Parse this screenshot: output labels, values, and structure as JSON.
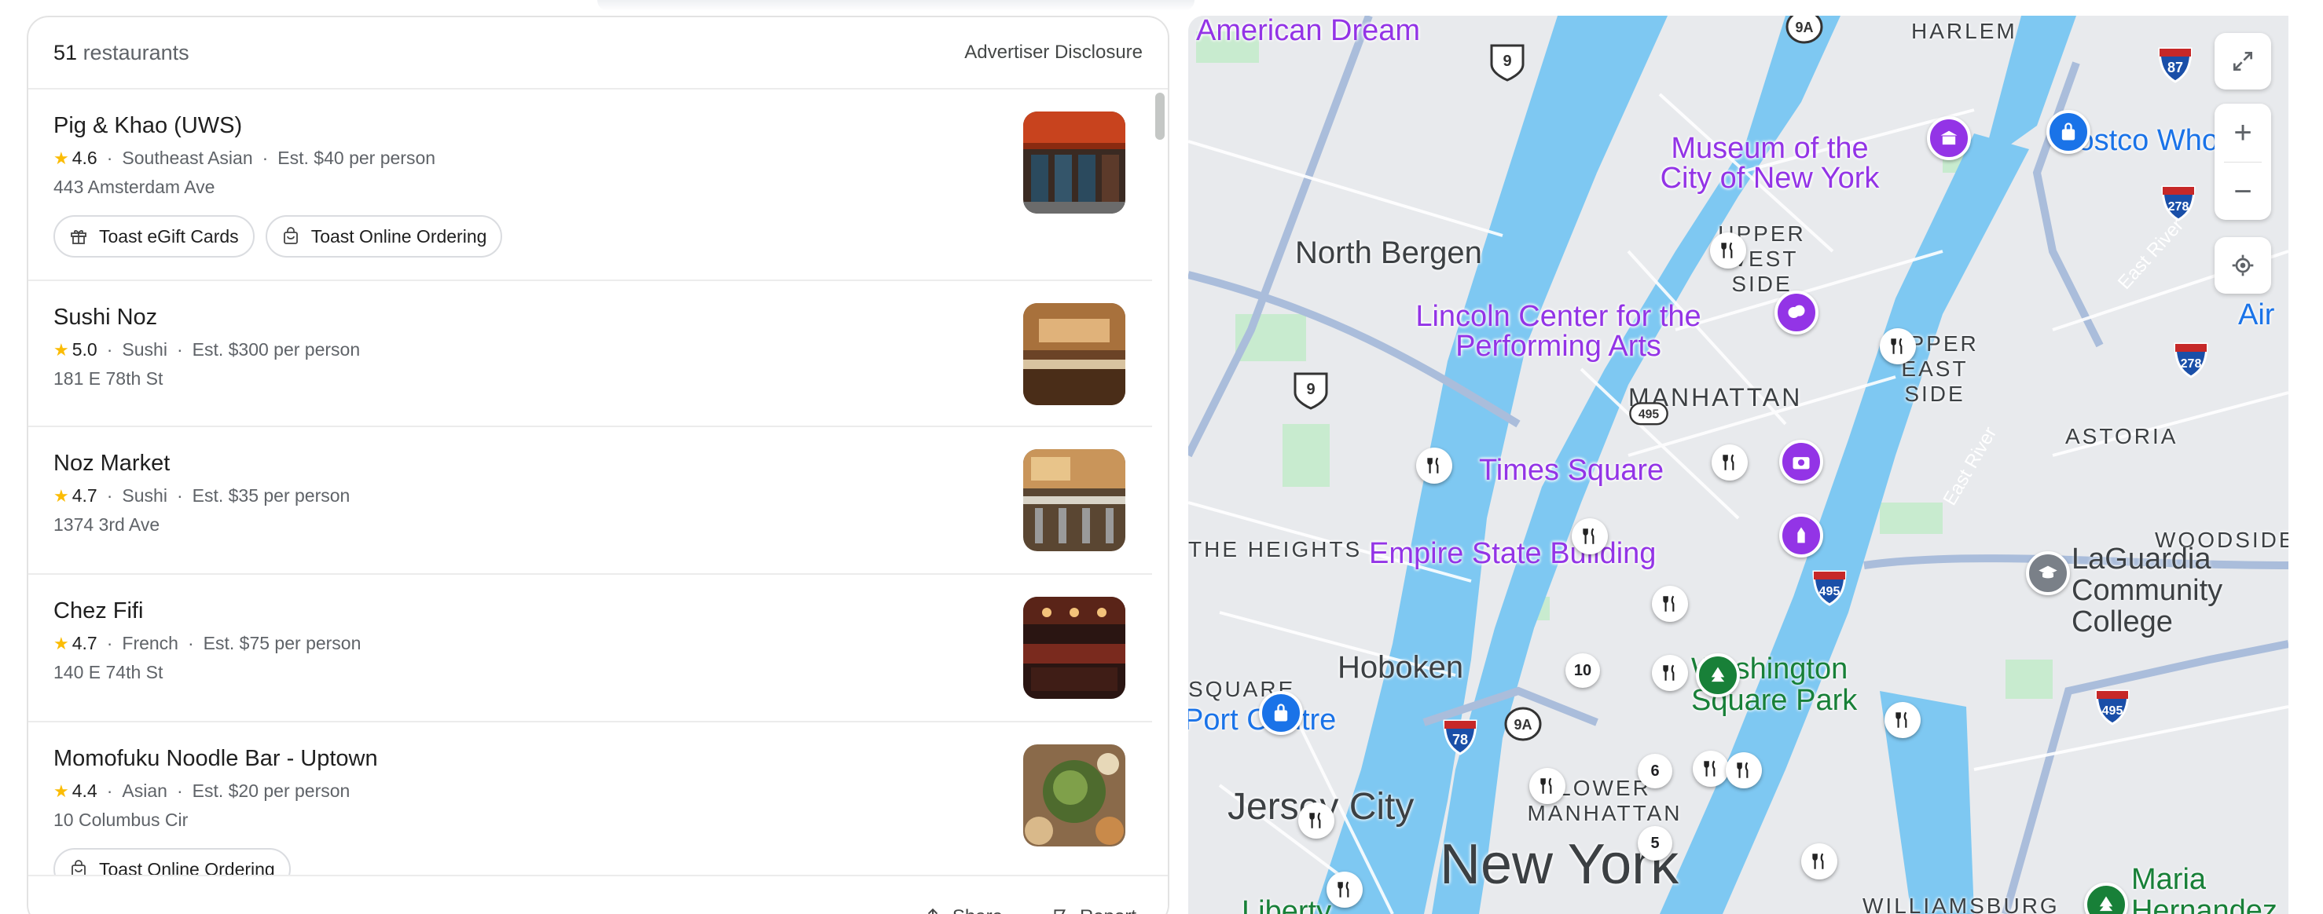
{
  "panel": {
    "count_number": "51",
    "count_label": "restaurants",
    "disclosure": "Advertiser Disclosure"
  },
  "restaurants": [
    {
      "name": "Pig & Khao (UWS)",
      "rating": "4.6",
      "cuisine": "Southeast Asian",
      "price": "Est. $40 per person",
      "address": "443 Amsterdam Ave",
      "chips": [
        "Toast eGift Cards",
        "Toast Online Ordering"
      ]
    },
    {
      "name": "Sushi Noz",
      "rating": "5.0",
      "cuisine": "Sushi",
      "price": "Est. $300 per person",
      "address": "181 E 78th St",
      "chips": []
    },
    {
      "name": "Noz Market",
      "rating": "4.7",
      "cuisine": "Sushi",
      "price": "Est. $35 per person",
      "address": "1374 3rd Ave",
      "chips": []
    },
    {
      "name": "Chez Fifi",
      "rating": "4.7",
      "cuisine": "French",
      "price": "Est. $75 per person",
      "address": "140 E 74th St",
      "chips": []
    },
    {
      "name": "Momofuku Noodle Bar - Uptown",
      "rating": "4.4",
      "cuisine": "Asian",
      "price": "Est. $20 per person",
      "address": "10 Columbus Cir",
      "chips": [
        "Toast Online Ordering"
      ]
    }
  ],
  "footer": {
    "share": "Share",
    "report": "Report"
  },
  "map": {
    "labels": {
      "american_dream": "American Dream",
      "harlem": "HARLEM",
      "museum": "Museum of the City of New York",
      "costco": "Costco Whole",
      "north_bergen": "North Bergen",
      "upper_west": "UPPER WEST SIDE",
      "upper_east": "UPPER EAST SIDE",
      "lincoln": "Lincoln Center for the Performing Arts",
      "manhattan": "MANHATTAN",
      "astoria": "ASTORIA",
      "times_square": "Times Square",
      "empire": "Empire State Building",
      "heights": "THE HEIGHTS",
      "woodside": "WOODSIDE",
      "laguardia": "LaGuardia Community College",
      "hoboken": "Hoboken",
      "square": "SQUARE",
      "port_centre": "Port Centre",
      "washington": "Washington Square Park",
      "lower_manhattan": "LOWER MANHATTAN",
      "jersey_city": "Jersey City",
      "new_york": "New York",
      "williamsburg": "WILLIAMSBURG",
      "liberty": "Liberty",
      "maria": "Maria Hernandez",
      "east_river_1": "East River",
      "east_river_2": "East River",
      "airport": "Air"
    },
    "shields": {
      "us9_top": "9",
      "us9_mid": "9",
      "i495": "495",
      "i87": "87",
      "i278_a": "278",
      "i278_b": "278",
      "i495_b": "495",
      "i495_c": "495",
      "i78": "78",
      "r9a": "9A",
      "r9a_top": "9A"
    },
    "clusters": {
      "c10": "10",
      "c6": "6",
      "c5": "5"
    }
  },
  "colors": {
    "water": "#7ec8f2",
    "land": "#e8eaed",
    "park": "#c8ebcf",
    "poi": "#9334e6",
    "star": "#fbbc04",
    "blue_marker": "#1a73e8",
    "green_marker": "#188038"
  }
}
